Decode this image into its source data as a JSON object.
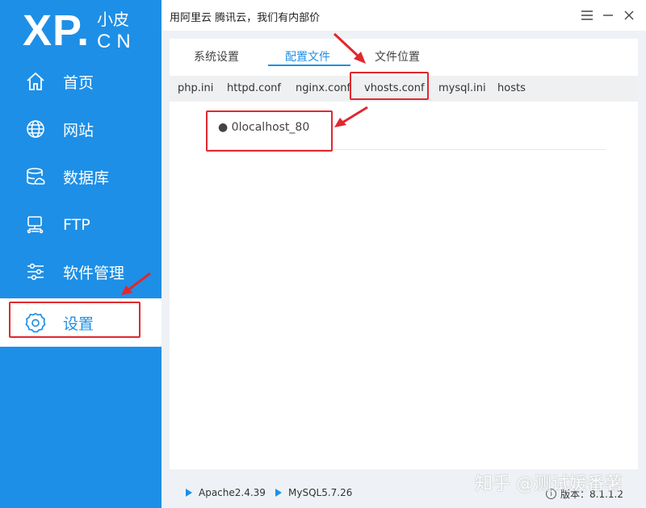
{
  "logo": {
    "brand": "XP.",
    "small": "小皮",
    "domain": "CN"
  },
  "sidebar": {
    "items": [
      {
        "label": "首页",
        "icon": "home-icon"
      },
      {
        "label": "网站",
        "icon": "globe-icon"
      },
      {
        "label": "数据库",
        "icon": "database-icon"
      },
      {
        "label": "FTP",
        "icon": "ftp-icon"
      },
      {
        "label": "软件管理",
        "icon": "sliders-icon"
      },
      {
        "label": "设置",
        "icon": "gear-icon",
        "active": true
      }
    ]
  },
  "titlebar": {
    "title": "用阿里云 腾讯云，我们有内部价"
  },
  "top_tabs": [
    {
      "label": "系统设置"
    },
    {
      "label": "配置文件",
      "active": true
    },
    {
      "label": "文件位置"
    }
  ],
  "sub_tabs": [
    {
      "label": "php.ini"
    },
    {
      "label": "httpd.conf"
    },
    {
      "label": "nginx.conf"
    },
    {
      "label": "vhosts.conf",
      "active": true
    },
    {
      "label": "mysql.ini"
    },
    {
      "label": "hosts"
    }
  ],
  "files": [
    {
      "label": "0localhost_80"
    }
  ],
  "statusbar": {
    "apache": "Apache2.4.39",
    "mysql": "MySQL5.7.26",
    "version": "版本：8.1.1.2",
    "watermark": "知乎 @测试媛番薯"
  },
  "colors": {
    "accent": "#1e8fe6",
    "highlight": "#e0282e"
  }
}
